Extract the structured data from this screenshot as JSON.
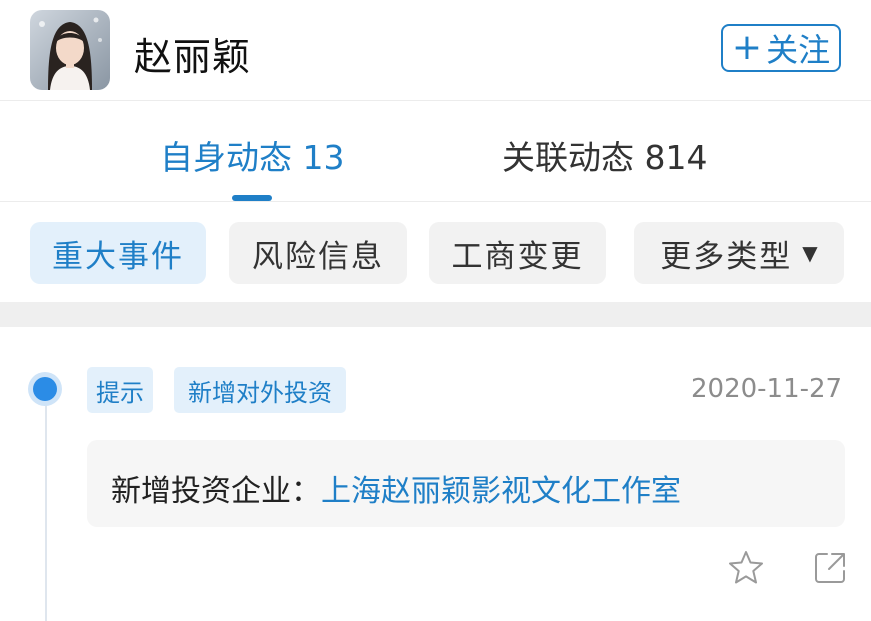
{
  "header": {
    "name": "赵丽颖",
    "follow_button": {
      "icon": "plus-icon",
      "label": "关注"
    }
  },
  "tabs": [
    {
      "label": "自身动态 13",
      "active": true
    },
    {
      "label": "关联动态 814",
      "active": false
    }
  ],
  "filters": [
    {
      "label": "重大事件",
      "active": true
    },
    {
      "label": "风险信息",
      "active": false
    },
    {
      "label": "工商变更",
      "active": false
    },
    {
      "label": "更多类型",
      "active": false,
      "icon": "caret-down-icon"
    }
  ],
  "timeline": {
    "items": [
      {
        "tags": [
          "提示",
          "新增对外投资"
        ],
        "date": "2020-11-27",
        "content": {
          "prefix": "新增投资企业：",
          "link_text": "上海赵丽颖影视文化工作室"
        },
        "actions": [
          "star-icon",
          "share-icon"
        ]
      }
    ]
  },
  "colors": {
    "accent": "#1f7fc7",
    "tag_bg": "#e3f0fb",
    "chip_bg": "#f2f2f2",
    "date_text": "#8c8c8c",
    "dot": "#2b8ce6"
  }
}
